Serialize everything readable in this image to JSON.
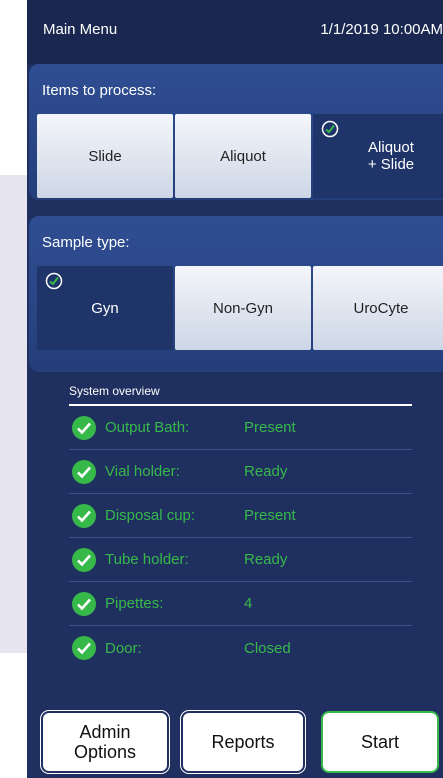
{
  "header": {
    "title": "Main Menu",
    "datetime": "1/1/2019 10:00AM"
  },
  "items_section": {
    "label": "Items to process:",
    "options": [
      {
        "label": "Slide",
        "selected": false
      },
      {
        "label": "Aliquot",
        "selected": false
      },
      {
        "label": "Aliquot\n+ Slide",
        "selected": true
      }
    ]
  },
  "sample_section": {
    "label": "Sample type:",
    "options": [
      {
        "label": "Gyn",
        "selected": true
      },
      {
        "label": "Non-Gyn",
        "selected": false
      },
      {
        "label": "UroCyte",
        "selected": false
      }
    ]
  },
  "overview": {
    "title": "System overview",
    "rows": [
      {
        "label": "Output Bath:",
        "value": "Present",
        "icon": "check-circle-icon"
      },
      {
        "label": "Vial holder:",
        "value": "Ready",
        "icon": "check-circle-icon"
      },
      {
        "label": "Disposal cup:",
        "value": "Present",
        "icon": "check-circle-icon"
      },
      {
        "label": "Tube holder:",
        "value": "Ready",
        "icon": "check-circle-icon"
      },
      {
        "label": "Pipettes:",
        "value": "4",
        "icon": "check-circle-icon"
      },
      {
        "label": "Door:",
        "value": "Closed",
        "icon": "check-circle-icon"
      }
    ]
  },
  "buttons": {
    "admin": "Admin\nOptions",
    "reports": "Reports",
    "start": "Start"
  },
  "colors": {
    "status_green": "#37b94a",
    "panel_blue": "#1f2f5f"
  }
}
